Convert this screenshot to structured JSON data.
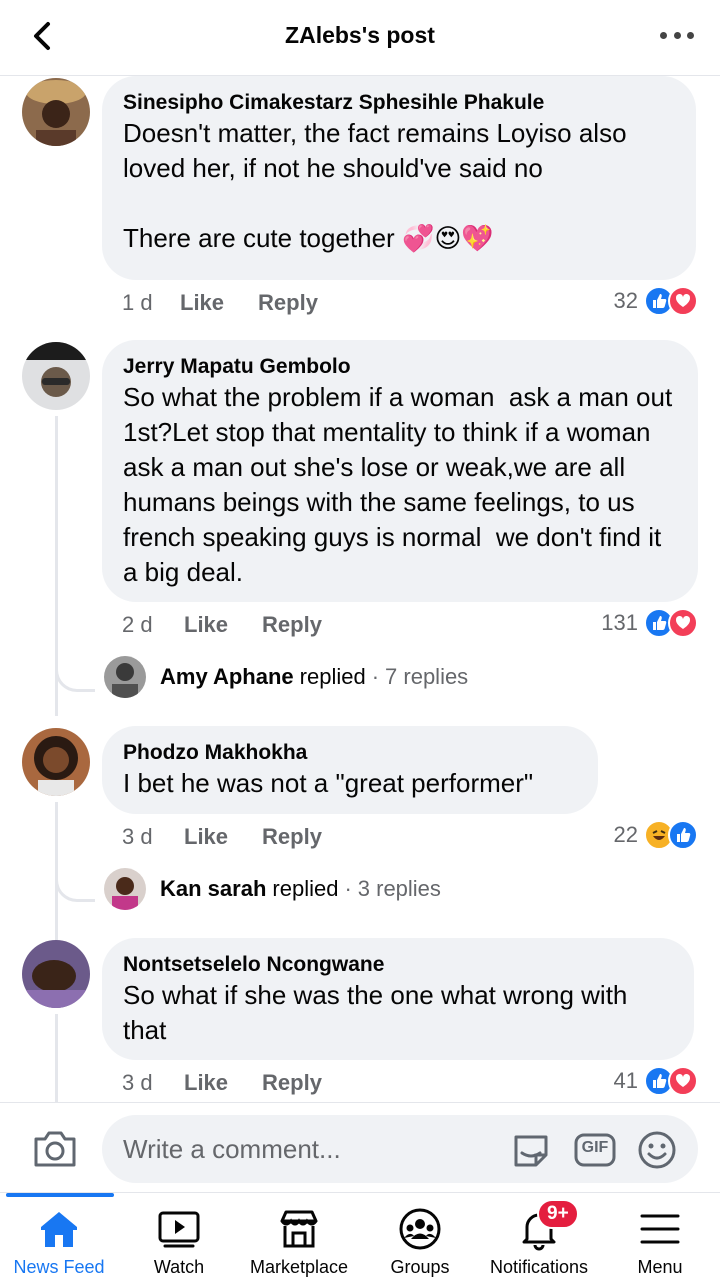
{
  "header": {
    "title": "ZAlebs's post"
  },
  "comments": [
    {
      "author": "Sinesipho Cimakestarz Sphesihle Phakule",
      "text": "Doesn't matter, the fact remains Loyiso also loved her, if not he should've said no\n\nThere are cute together 💞😍💖",
      "age": "1 d",
      "like_label": "Like",
      "reply_label": "Reply",
      "reaction_count": "32"
    },
    {
      "author": "Jerry Mapatu Gembolo",
      "text": "So what the problem if a woman  ask a man out 1st?Let stop that mentality to think if a woman  ask a man out she's lose or weak,we are all humans beings with the same feelings, to us french speaking guys is normal  we don't find it a big deal.",
      "age": "2 d",
      "like_label": "Like",
      "reply_label": "Reply",
      "reaction_count": "131",
      "replies": {
        "name": "Amy Aphane",
        "verb": "replied",
        "dot": "·",
        "count": "7 replies"
      }
    },
    {
      "author": "Phodzo Makhokha",
      "text": "I bet he was not a \"great performer\"",
      "age": "3 d",
      "like_label": "Like",
      "reply_label": "Reply",
      "reaction_count": "22",
      "replies": {
        "name": "Kan sarah",
        "verb": "replied",
        "dot": "·",
        "count": "3 replies"
      }
    },
    {
      "author": "Nontsetselelo Ncongwane",
      "text": "So what if she was the one what wrong with that",
      "age": "3 d",
      "like_label": "Like",
      "reply_label": "Reply",
      "reaction_count": "41"
    }
  ],
  "composer": {
    "placeholder": "Write a comment...",
    "gif_label": "GIF"
  },
  "nav": {
    "items": [
      {
        "label": "News Feed"
      },
      {
        "label": "Watch"
      },
      {
        "label": "Marketplace"
      },
      {
        "label": "Groups"
      },
      {
        "label": "Notifications",
        "badge": "9+"
      },
      {
        "label": "Menu"
      }
    ]
  },
  "colors": {
    "accent": "#1877f2",
    "love": "#f33e58",
    "bubble": "#f0f2f5",
    "badge": "#e41e3f"
  }
}
